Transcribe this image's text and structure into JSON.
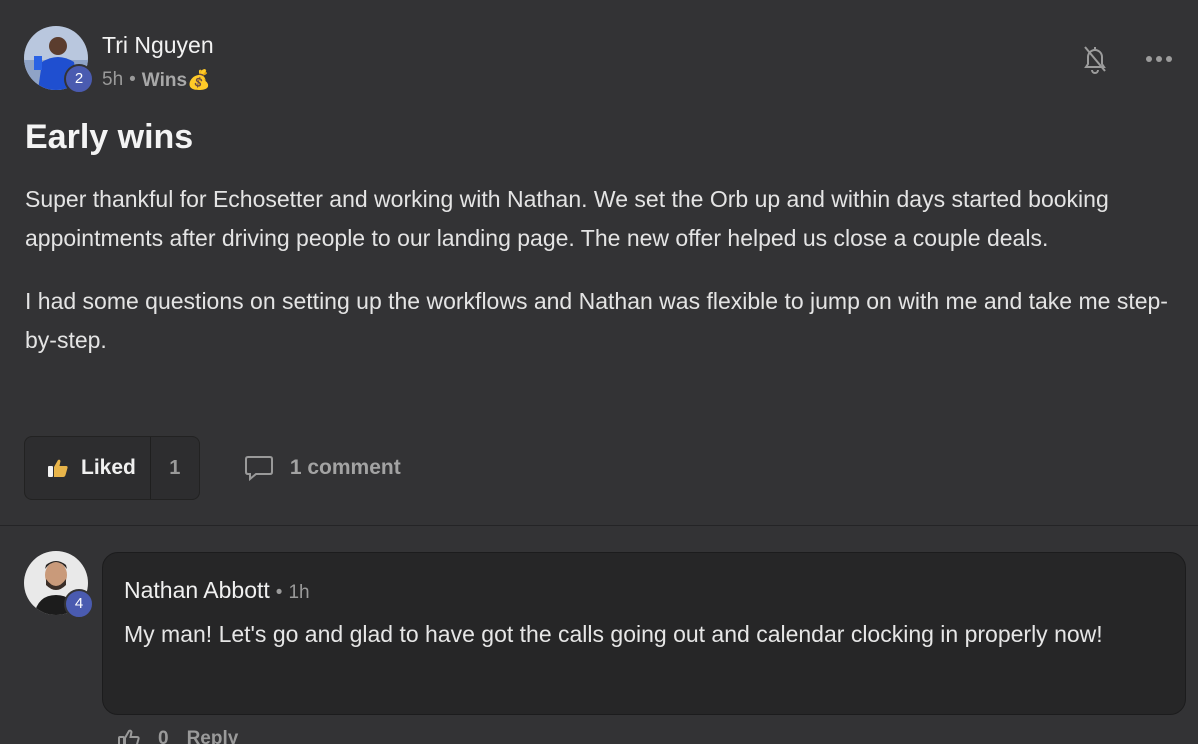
{
  "post": {
    "author": "Tri Nguyen",
    "author_level": "2",
    "time": "5h",
    "separator": "•",
    "category": "Wins💰",
    "title": "Early wins",
    "paragraphs": [
      "Super thankful for Echosetter and working with Nathan. We set the Orb up and within days started booking appointments after driving people to our landing page. The new offer helped us close a couple deals.",
      "I had some questions on setting up the workflows and Nathan was flexible to jump on with me and take me step-by-step."
    ],
    "like_label": "Liked",
    "like_count": "1",
    "comment_label": "1 comment"
  },
  "comment": {
    "author": "Nathan Abbott",
    "author_level": "4",
    "separator": "•",
    "time": "1h",
    "text": "My man! Let's go and glad to have got the calls going out and calendar clocking in properly now!",
    "like_count": "0",
    "reply_label": "Reply"
  },
  "icons": {
    "notify": "bell-off-icon",
    "more": "more-dots-icon",
    "like": "thumbs-up-icon",
    "comment": "comment-icon"
  },
  "colors": {
    "background": "#333335",
    "badge": "#4a5bb0",
    "bubble": "#262627",
    "like_accent": "#e8b44a"
  }
}
